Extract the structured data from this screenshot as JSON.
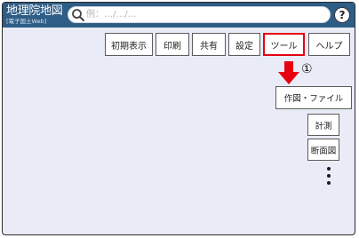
{
  "header": {
    "logo_title": "地理院地図",
    "logo_subtitle": "[電子国土Web]",
    "search_placeholder": "例：…/…/…",
    "help_label": "?"
  },
  "menu": {
    "items": [
      {
        "label": "初期表示"
      },
      {
        "label": "印刷"
      },
      {
        "label": "共有"
      },
      {
        "label": "設定"
      },
      {
        "label": "ツール",
        "highlighted": true
      },
      {
        "label": "ヘルプ"
      }
    ]
  },
  "annotation": {
    "step_marker": "①",
    "highlight_color": "#e60012"
  },
  "tools_submenu": {
    "items": [
      {
        "label": "作図・ファイル",
        "highlighted": true
      },
      {
        "label": "計測"
      },
      {
        "label": "断面図"
      }
    ],
    "more_icon": "vertical-ellipsis-icon"
  },
  "colors": {
    "header_bg": "#2e5d86",
    "map_bg": "#e9ecf7",
    "highlight": "#e60012"
  }
}
